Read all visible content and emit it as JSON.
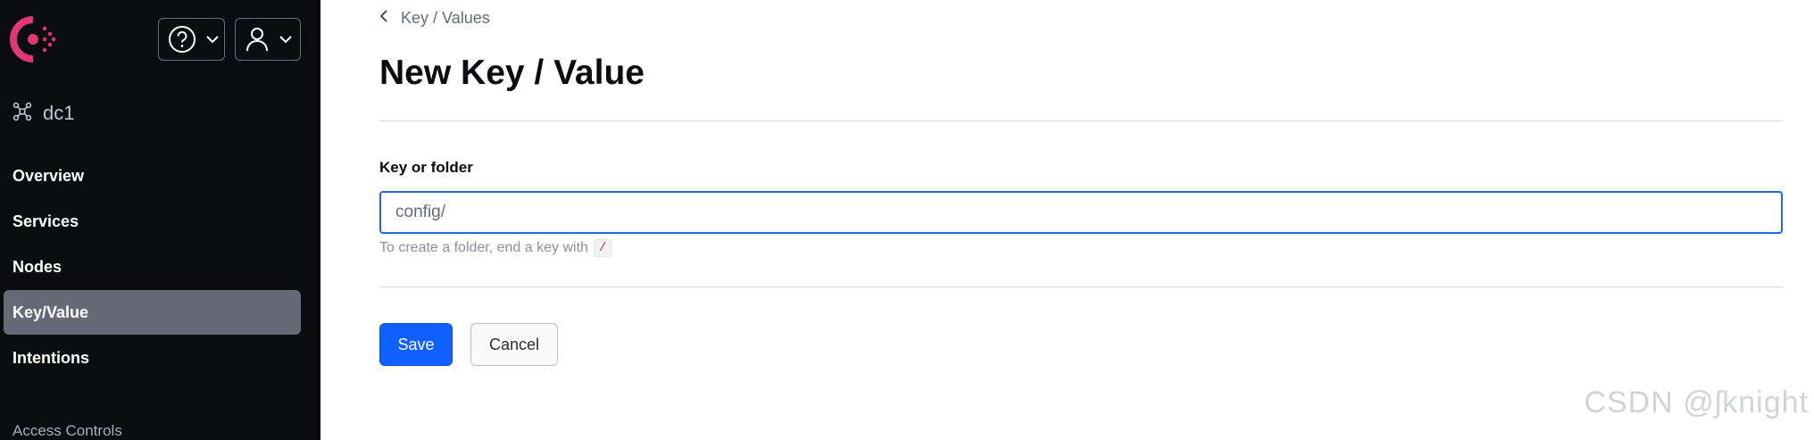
{
  "sidebar": {
    "datacenter": "dc1",
    "nav": [
      "Overview",
      "Services",
      "Nodes",
      "Key/Value",
      "Intentions"
    ],
    "active_item": "Key/Value",
    "section_heading": "Access Controls"
  },
  "header": {
    "breadcrumb": "Key / Values",
    "title": "New Key / Value"
  },
  "form": {
    "label": "Key or folder",
    "value": "config/",
    "hint": "To create a folder, end a key with",
    "hint_code": "/",
    "save_label": "Save",
    "cancel_label": "Cancel"
  },
  "watermark": "CSDN @ʃknight",
  "colors": {
    "sidebar_bg": "#0b0c0f",
    "active_nav": "#656a76",
    "brand": "#e03875",
    "primary": "#1060ff",
    "focus": "#1c6cd9"
  }
}
